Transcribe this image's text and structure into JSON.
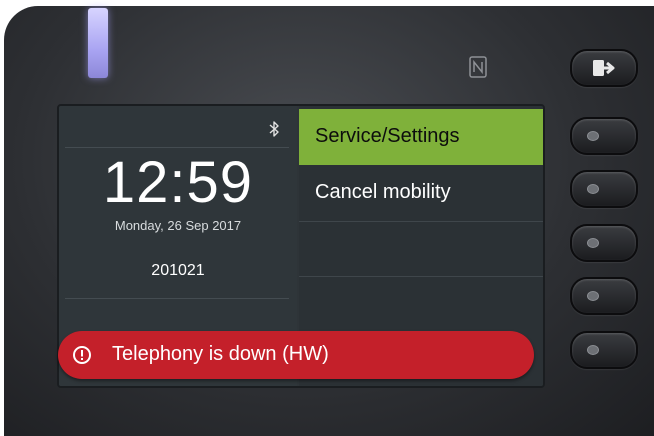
{
  "status": {
    "bluetooth_icon": "bluetooth-icon",
    "nfc_icon": "nfc-icon"
  },
  "idle": {
    "time": "12:59",
    "date": "Monday, 26 Sep 2017",
    "extension": "201021"
  },
  "menu": {
    "items": [
      {
        "label": "Service/Settings",
        "selected": true
      },
      {
        "label": "Cancel mobility",
        "selected": false
      }
    ],
    "selected_color": "#7fb13a"
  },
  "alert": {
    "text": "Telephony is down (HW)",
    "icon": "alert-circle-icon",
    "color": "#c4202a"
  },
  "hardware": {
    "led_color": "#b3aef6",
    "exit_key_icon": "logout-arrow-icon"
  }
}
